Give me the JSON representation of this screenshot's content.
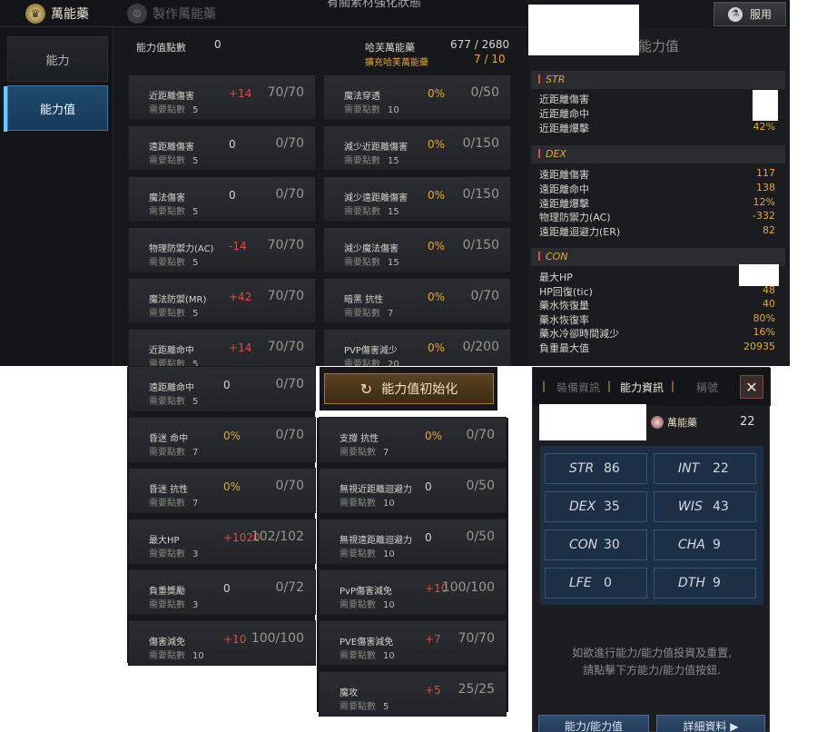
{
  "window": {
    "top_caption": "有關素材強化狀態",
    "tabs": [
      {
        "label": "萬能藥",
        "icon": "potion-emblem-icon"
      },
      {
        "label": "製作萬能藥",
        "icon": "gears-icon"
      }
    ],
    "use_button": "服用"
  },
  "sidebar": [
    {
      "label": "能力"
    },
    {
      "label": "能力值"
    }
  ],
  "summary": {
    "points_label": "能力值點數",
    "points_value": "0",
    "potion_label": "哈芙萬能藥",
    "potion_value": "677 / 2680",
    "expand_label": "擴充哈芙萬能藥",
    "expand_value": "7 / 10"
  },
  "req_label": "需要點數",
  "cards_top_left": [
    {
      "name": "近距離傷害",
      "req": "5",
      "bonus": "+14",
      "value": "70/70"
    },
    {
      "name": "遠距離傷害",
      "req": "5",
      "bonus": "0",
      "value": "0/70"
    },
    {
      "name": "魔法傷害",
      "req": "5",
      "bonus": "0",
      "value": "0/70"
    },
    {
      "name": "物理防禦力(AC)",
      "req": "5",
      "bonus": "-14",
      "value": "70/70"
    },
    {
      "name": "魔法防禦(MR)",
      "req": "5",
      "bonus": "+42",
      "value": "70/70"
    },
    {
      "name": "近距離命中",
      "req": "5",
      "bonus": "+14",
      "value": "70/70"
    }
  ],
  "cards_top_right": [
    {
      "name": "魔法穿透",
      "req": "10",
      "bonus": "0%",
      "value": "0/50"
    },
    {
      "name": "減少近距離傷害",
      "req": "15",
      "bonus": "0%",
      "value": "0/150"
    },
    {
      "name": "減少遠距離傷害",
      "req": "15",
      "bonus": "0%",
      "value": "0/150"
    },
    {
      "name": "減少魔法傷害",
      "req": "15",
      "bonus": "0%",
      "value": "0/150"
    },
    {
      "name": "暗黑 抗性",
      "req": "7",
      "bonus": "0%",
      "value": "0/70"
    },
    {
      "name": "PVP傷害減少",
      "req": "20",
      "bonus": "0%",
      "value": "0/200"
    }
  ],
  "cards_bottom_left": [
    {
      "name": "遠距離命中",
      "req": "5",
      "bonus": "0",
      "value": "0/70"
    },
    {
      "name": "昏迷 命中",
      "req": "7",
      "bonus": "0%",
      "value": "0/70"
    },
    {
      "name": "昏迷 抗性",
      "req": "7",
      "bonus": "0%",
      "value": "0/70"
    },
    {
      "name": "最大HP",
      "req": "3",
      "bonus": "+1020",
      "value": "102/102"
    },
    {
      "name": "負重獎勵",
      "req": "3",
      "bonus": "0",
      "value": "0/72"
    },
    {
      "name": "傷害減免",
      "req": "10",
      "bonus": "+10",
      "value": "100/100"
    }
  ],
  "cards_bottom_right": [
    {
      "name": "支撐 抗性",
      "req": "7",
      "bonus": "0%",
      "value": "0/70"
    },
    {
      "name": "無視近距離迴避力",
      "req": "10",
      "bonus": "0",
      "value": "0/50"
    },
    {
      "name": "無視遠距離迴避力",
      "req": "10",
      "bonus": "0",
      "value": "0/50"
    },
    {
      "name": "PvP傷害減免",
      "req": "10",
      "bonus": "+10",
      "value": "100/100"
    },
    {
      "name": "PVE傷害減免",
      "req": "10",
      "bonus": "+7",
      "value": "70/70"
    },
    {
      "name": "魔攻",
      "req": "5",
      "bonus": "+5",
      "value": "25/25"
    }
  ],
  "reset_button": "能力值初始化",
  "stat_panel": {
    "title": "能力值",
    "groups": [
      {
        "head": "STR",
        "rows": [
          {
            "label": "近距離傷害",
            "value": ""
          },
          {
            "label": "近距離命中",
            "value": ""
          },
          {
            "label": "近距離爆擊",
            "value": "42%"
          }
        ]
      },
      {
        "head": "DEX",
        "rows": [
          {
            "label": "遠距離傷害",
            "value": "117"
          },
          {
            "label": "遠距離命中",
            "value": "138"
          },
          {
            "label": "遠距離爆擊",
            "value": "12%"
          },
          {
            "label": "物理防禦力(AC)",
            "value": "-332"
          },
          {
            "label": "遠距離迴避力(ER)",
            "value": "82"
          }
        ]
      },
      {
        "head": "CON",
        "rows": [
          {
            "label": "最大HP",
            "value": ""
          },
          {
            "label": "HP回復(tic)",
            "value": "48"
          },
          {
            "label": "藥水恢復量",
            "value": "40"
          },
          {
            "label": "藥水恢復率",
            "value": "80%"
          },
          {
            "label": "藥水冷卻時間減少",
            "value": "16%"
          },
          {
            "label": "負重最大值",
            "value": "20935"
          }
        ]
      }
    ]
  },
  "char_panel": {
    "tabs": [
      "裝備資訊",
      "能力資訊",
      "稱號"
    ],
    "potion_label": "萬能藥",
    "potion_count": "22",
    "stats": [
      {
        "k": "STR",
        "n": "86"
      },
      {
        "k": "INT",
        "n": "22"
      },
      {
        "k": "DEX",
        "n": "35"
      },
      {
        "k": "WIS",
        "n": "43"
      },
      {
        "k": "CON",
        "n": "30"
      },
      {
        "k": "CHA",
        "n": "9"
      },
      {
        "k": "LFE",
        "n": "0"
      },
      {
        "k": "DTH",
        "n": "9"
      }
    ],
    "note_line1": "如欲進行能力/能力值投資及重置,",
    "note_line2": "請點擊下方能力/能力值按鈕.",
    "btn_ability": "能力/能力值",
    "btn_detail": "詳細資料 ▶",
    "close": "✕"
  }
}
